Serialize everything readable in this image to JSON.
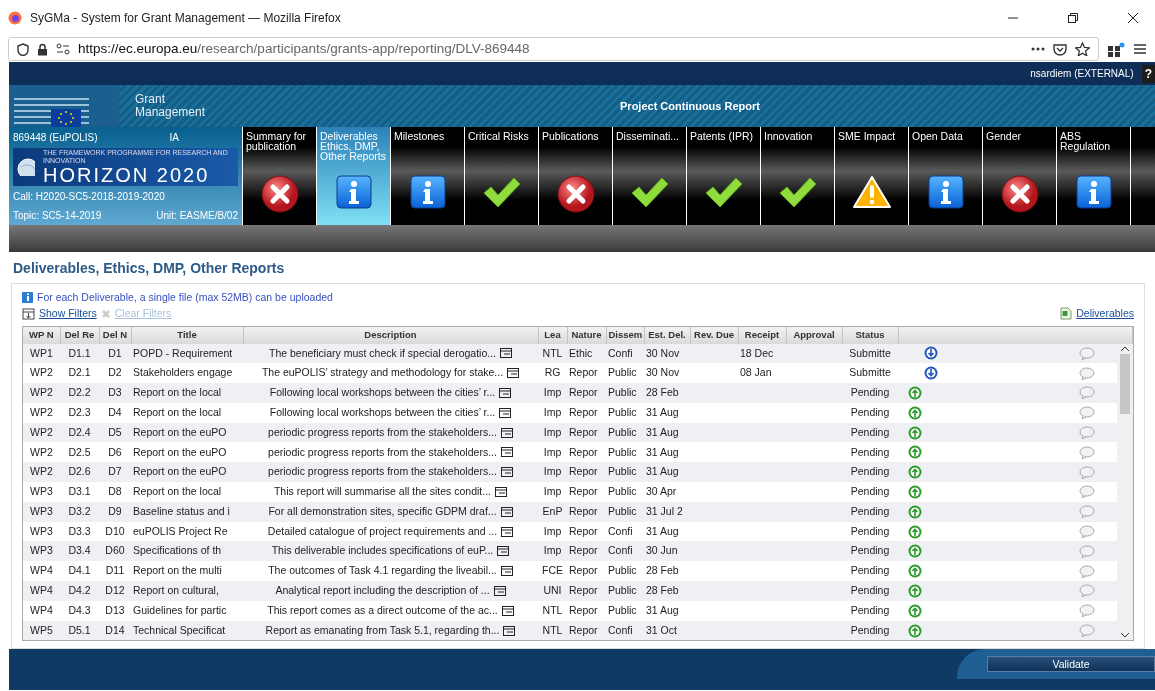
{
  "browser": {
    "title": "SyGMa - System for Grant Management — Mozilla Firefox",
    "url_host": "https://ec.europa.eu",
    "url_path": "/research/participants/grants-app/reporting/DLV-869448"
  },
  "user": "nsardiem (EXTERNAL)",
  "help": "?",
  "app": {
    "name": "Grant Management",
    "title": "Project Continuous Report"
  },
  "project": {
    "id": "869448 (EuPOLIS)",
    "type": "IA",
    "programme_tagline": "THE FRAMEWORK PROGRAMME FOR RESEARCH AND INNOVATION",
    "programme": "HORIZON 2020",
    "call": "Call: H2020-SC5-2018-2019-2020",
    "topic": "Topic: SC5-14-2019",
    "unit": "Unit: EASME/B/02"
  },
  "tabs": [
    {
      "label": "Summary for publication",
      "kind": "error",
      "selected": false
    },
    {
      "label": "Deliverables Ethics, DMP, Other Reports",
      "kind": "info",
      "selected": true
    },
    {
      "label": "Milestones",
      "kind": "info",
      "selected": false
    },
    {
      "label": "Critical Risks",
      "kind": "ok",
      "selected": false
    },
    {
      "label": "Publications",
      "kind": "error",
      "selected": false
    },
    {
      "label": "Disseminati...",
      "kind": "ok",
      "selected": false
    },
    {
      "label": "Patents (IPR)",
      "kind": "ok",
      "selected": false
    },
    {
      "label": "Innovation",
      "kind": "ok",
      "selected": false
    },
    {
      "label": "SME Impact",
      "kind": "warning",
      "selected": false
    },
    {
      "label": "Open Data",
      "kind": "info",
      "selected": false
    },
    {
      "label": "Gender",
      "kind": "error",
      "selected": false
    },
    {
      "label": "ABS Regulation",
      "kind": "info",
      "selected": false
    }
  ],
  "section_title": "Deliverables, Ethics, DMP, Other Reports",
  "notice": "For each Deliverable, a single file (max 52MB) can be uploaded",
  "filters": [
    {
      "label": "Show Filters",
      "disabled": false
    },
    {
      "label": "Clear Filters",
      "disabled": true
    }
  ],
  "export_link": "Deliverables",
  "table": {
    "columns": [
      "WP N",
      "Del Re",
      "Del N",
      "Title",
      "Description",
      "Lea",
      "Nature",
      "Dissem",
      "Est. Del.",
      "Rev. Due",
      "Receipt",
      "Approval",
      "Status"
    ],
    "rows": [
      {
        "wp": "WP1",
        "del_ref": "D1.1",
        "del_no": "D1",
        "title": "POPD - Requirement",
        "description": "The beneficiary must check if special derogatio...",
        "lead": "NTL",
        "nature": "Ethic",
        "dissem": "Confi",
        "est_del": "30 Nov",
        "receipt": "18 Dec",
        "status": "Submitte",
        "kind": "download"
      },
      {
        "wp": "WP2",
        "del_ref": "D2.1",
        "del_no": "D2",
        "title": "Stakeholders engage",
        "description": "The euPOLIS’ strategy and methodology for stake...",
        "lead": "RG",
        "nature": "Repor",
        "dissem": "Public",
        "est_del": "30 Nov",
        "receipt": "08 Jan",
        "status": "Submitte",
        "kind": "download"
      },
      {
        "wp": "WP2",
        "del_ref": "D2.2",
        "del_no": "D3",
        "title": "Report on the local",
        "description": "Following local workshops between the cities’ r...",
        "lead": "Imp",
        "nature": "Repor",
        "dissem": "Public",
        "est_del": "28 Feb",
        "status": "Pending",
        "kind": "upload"
      },
      {
        "wp": "WP2",
        "del_ref": "D2.3",
        "del_no": "D4",
        "title": "Report on the local",
        "description": "Following local workshops between the cities’ r...",
        "lead": "Imp",
        "nature": "Repor",
        "dissem": "Public",
        "est_del": "31 Aug",
        "status": "Pending",
        "kind": "upload"
      },
      {
        "wp": "WP2",
        "del_ref": "D2.4",
        "del_no": "D5",
        "title": "Report on the euPO",
        "description": "periodic progress reports from the stakeholders...",
        "lead": "Imp",
        "nature": "Repor",
        "dissem": "Public",
        "est_del": "31 Aug",
        "status": "Pending",
        "kind": "upload"
      },
      {
        "wp": "WP2",
        "del_ref": "D2.5",
        "del_no": "D6",
        "title": "Report on the euPO",
        "description": "periodic progress reports from the stakeholders...",
        "lead": "Imp",
        "nature": "Repor",
        "dissem": "Public",
        "est_del": "31 Aug",
        "status": "Pending",
        "kind": "upload"
      },
      {
        "wp": "WP2",
        "del_ref": "D2.6",
        "del_no": "D7",
        "title": "Report on the euPO",
        "description": "periodic progress reports from the stakeholders...",
        "lead": "Imp",
        "nature": "Repor",
        "dissem": "Public",
        "est_del": "31 Aug",
        "status": "Pending",
        "kind": "upload"
      },
      {
        "wp": "WP3",
        "del_ref": "D3.1",
        "del_no": "D8",
        "title": "Report on the local",
        "description": "This report will summarise all the sites condit...",
        "lead": "Imp",
        "nature": "Repor",
        "dissem": "Public",
        "est_del": "30 Apr",
        "status": "Pending",
        "kind": "upload"
      },
      {
        "wp": "WP3",
        "del_ref": "D3.2",
        "del_no": "D9",
        "title": "Baseline status and i",
        "description": "For all demonstration sites, specific GDPM draf...",
        "lead": "EnP",
        "nature": "Repor",
        "dissem": "Public",
        "est_del": "31 Jul 2",
        "status": "Pending",
        "kind": "upload"
      },
      {
        "wp": "WP3",
        "del_ref": "D3.3",
        "del_no": "D10",
        "title": "euPOLIS Project Re",
        "description": "Detailed catalogue of project requirements and ...",
        "lead": "Imp",
        "nature": "Repor",
        "dissem": "Confi",
        "est_del": "31 Aug",
        "status": "Pending",
        "kind": "upload"
      },
      {
        "wp": "WP3",
        "del_ref": "D3.4",
        "del_no": "D60",
        "title": "Specifications of th",
        "description": "This deliverable includes specifications of euP...",
        "lead": "Imp",
        "nature": "Repor",
        "dissem": "Confi",
        "est_del": "30 Jun",
        "status": "Pending",
        "kind": "upload"
      },
      {
        "wp": "WP4",
        "del_ref": "D4.1",
        "del_no": "D11",
        "title": "Report on the multi",
        "description": "The outcomes of Task 4.1 regarding the liveabil...",
        "lead": "FCE",
        "nature": "Repor",
        "dissem": "Public",
        "est_del": "28 Feb",
        "status": "Pending",
        "kind": "upload"
      },
      {
        "wp": "WP4",
        "del_ref": "D4.2",
        "del_no": "D12",
        "title": "Report on cultural,",
        "description": "Analytical report including the description of ...",
        "lead": "UNI",
        "nature": "Repor",
        "dissem": "Public",
        "est_del": "28 Feb",
        "status": "Pending",
        "kind": "upload"
      },
      {
        "wp": "WP4",
        "del_ref": "D4.3",
        "del_no": "D13",
        "title": "Guidelines for partic",
        "description": "This report comes as a direct outcome of the ac...",
        "lead": "NTL",
        "nature": "Repor",
        "dissem": "Public",
        "est_del": "31 Aug",
        "status": "Pending",
        "kind": "upload"
      },
      {
        "wp": "WP5",
        "del_ref": "D5.1",
        "del_no": "D14",
        "title": "Technical Specificat",
        "description": "Report as emanating from Task 5.1, regarding th...",
        "lead": "NTL",
        "nature": "Repor",
        "dissem": "Confi",
        "est_del": "31 Oct",
        "status": "Pending",
        "kind": "upload"
      }
    ]
  },
  "validate_button": "Validate"
}
